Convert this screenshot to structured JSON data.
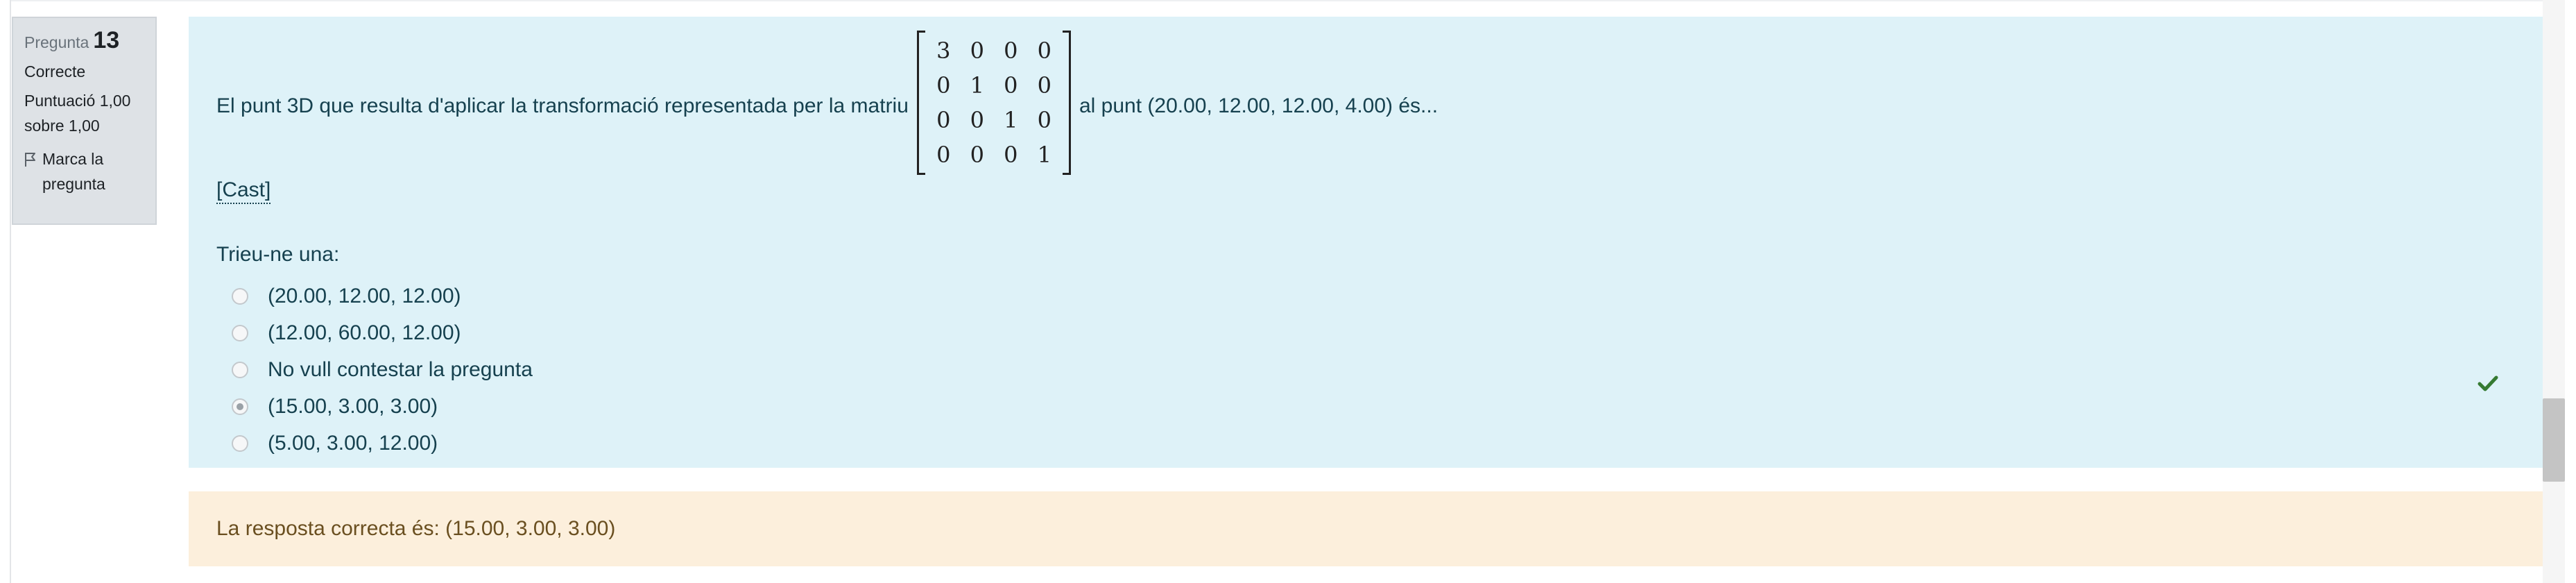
{
  "info": {
    "question_label": "Pregunta",
    "question_number": "13",
    "state": "Correcte",
    "grade": "Puntuació 1,00 sobre 1,00",
    "flag_label": "Marca la pregunta"
  },
  "question": {
    "text_before": "El punt 3D que resulta d'aplicar la transformació representada per la matriu",
    "text_after": "al punt (20.00, 12.00, 12.00, 4.00) és...",
    "matrix": [
      [
        "3",
        "0",
        "0",
        "0"
      ],
      [
        "0",
        "1",
        "0",
        "0"
      ],
      [
        "0",
        "0",
        "1",
        "0"
      ],
      [
        "0",
        "0",
        "0",
        "1"
      ]
    ],
    "cast_link": "[Cast]",
    "prompt": "Trieu-ne una:",
    "answers": [
      {
        "label": "(20.00, 12.00, 12.00)",
        "selected": false
      },
      {
        "label": "(12.00, 60.00, 12.00)",
        "selected": false
      },
      {
        "label": "No vull contestar la pregunta",
        "selected": false
      },
      {
        "label": "(15.00, 3.00, 3.00)",
        "selected": true
      },
      {
        "label": "(5.00, 3.00, 12.00)",
        "selected": false
      }
    ],
    "correct_icon": "check-icon",
    "correct_color": "#357a32"
  },
  "feedback": {
    "right_answer": "La resposta correcta és: (15.00, 3.00, 3.00)"
  },
  "colors": {
    "question_bg": "#def2f8",
    "feedback_bg": "#fcefdc",
    "info_bg": "#dee2e6"
  }
}
